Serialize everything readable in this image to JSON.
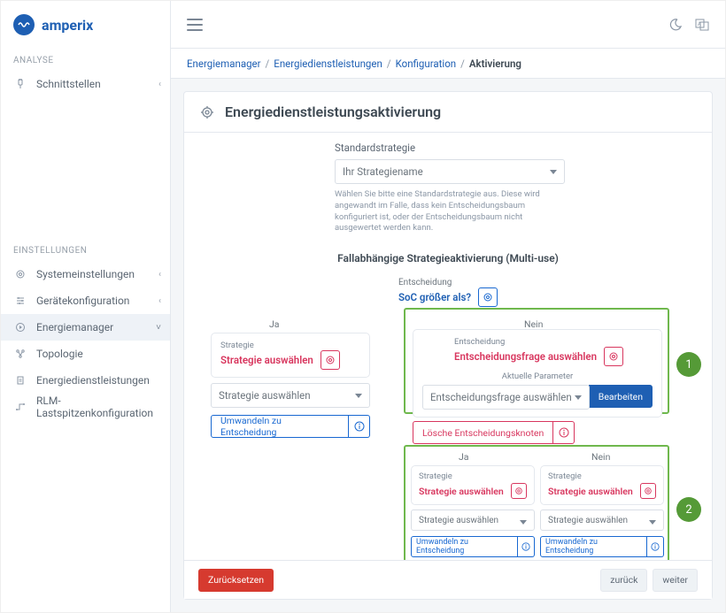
{
  "brand": {
    "name": "amperix",
    "logo_glyph": "~"
  },
  "topbar": {
    "theme_icon": "moon",
    "lang_icon": "translate"
  },
  "breadcrumb": {
    "items": [
      {
        "label": "Energiemanager"
      },
      {
        "label": "Energiedienstleistungen"
      },
      {
        "label": "Konfiguration"
      }
    ],
    "current": "Aktivierung",
    "sep": "/"
  },
  "nav": {
    "sections": [
      {
        "label": "ANALYSE",
        "items": [
          {
            "label": "Schnittstellen",
            "icon": "plug",
            "chev": true
          }
        ]
      },
      {
        "label": "EINSTELLUNGEN",
        "items": [
          {
            "label": "Systemeinstellungen",
            "icon": "gear",
            "chev": true
          },
          {
            "label": "Gerätekonfiguration",
            "icon": "sliders",
            "chev": true
          },
          {
            "label": "Energiemanager",
            "icon": "cog-play",
            "chev": true,
            "expanded": true
          },
          {
            "label": "Topologie",
            "icon": "nodes"
          },
          {
            "label": "Energiedienstleistungen",
            "icon": "doc"
          },
          {
            "label": "RLM-Lastspitzenkonfiguration",
            "icon": "route"
          }
        ]
      }
    ]
  },
  "page": {
    "title": "Energiedienstleistungsaktivierung",
    "standard_label": "Standardstrategie",
    "standard_option": "Ihr Strategiename",
    "help": "Wählen Sie bitte eine Standardstrategie aus. Diese wird angewandt im Falle, dass kein Entscheidungsbaum konfiguriert ist, oder der Entscheidungsbaum nicht ausgewertet werden kann.",
    "subtitle": "Fallabhängige Strategieaktivierung (Multi-use)"
  },
  "tree": {
    "decision_label": "Entscheidung",
    "root_q": "SoC größer als?",
    "yes": "Ja",
    "no": "Nein",
    "strategy_label": "Strategie",
    "strategy_pick": "Strategie auswählen",
    "strategy_select": "Strategie auswählen",
    "convert": "Umwandeln zu Entscheidung",
    "decision_pick": "Entscheidungsfrage auswählen",
    "current_params": "Aktuelle Parameter",
    "decision_select": "Entscheidungsfrage auswählen",
    "edit": "Bearbeiten",
    "delete_decision": "Lösche Entscheidungsknoten"
  },
  "annotations": {
    "one": "1",
    "two": "2"
  },
  "footer": {
    "reset": "Zurücksetzen",
    "back": "zurück",
    "next": "weiter"
  }
}
